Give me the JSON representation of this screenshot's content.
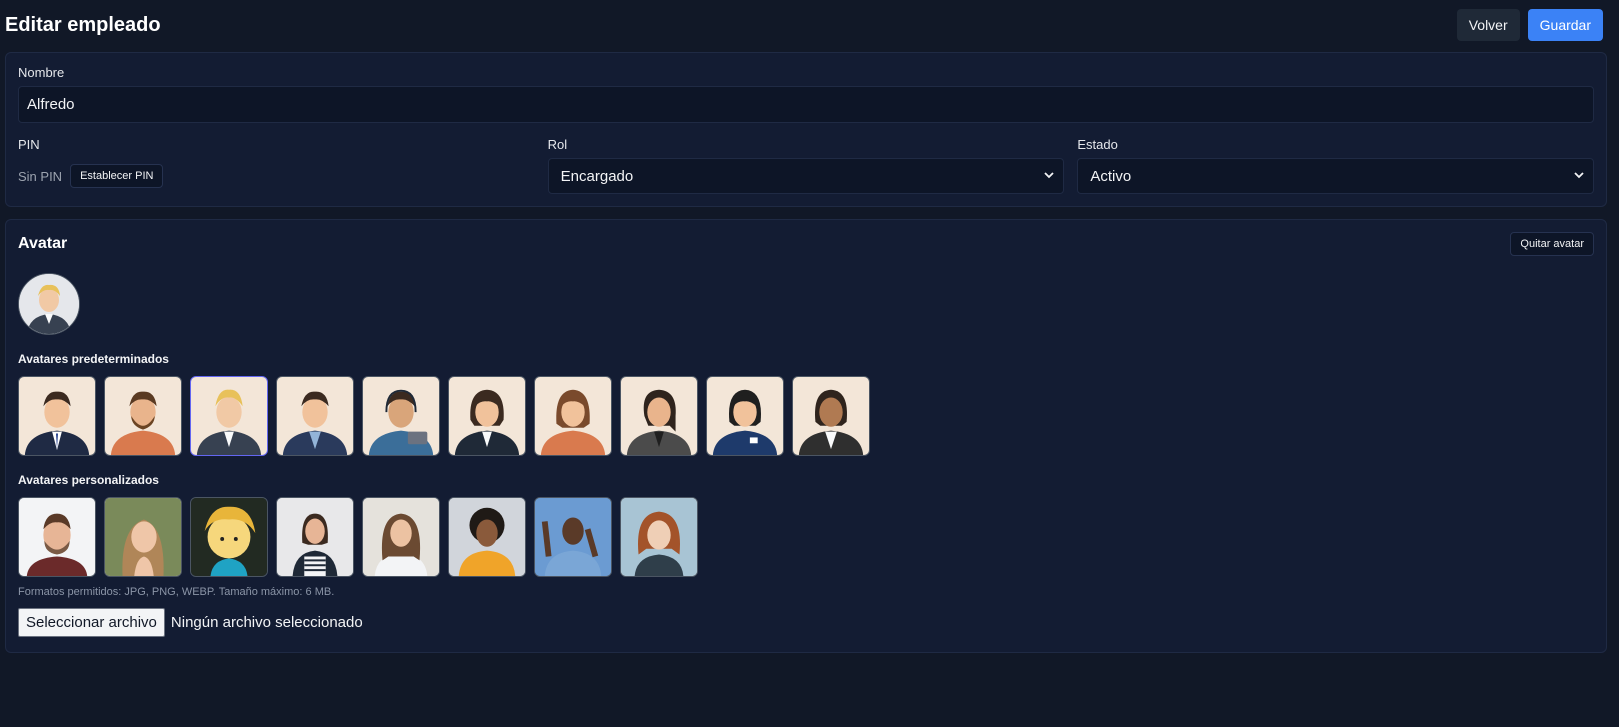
{
  "header": {
    "title": "Editar empleado",
    "back_label": "Volver",
    "save_label": "Guardar"
  },
  "form": {
    "name_label": "Nombre",
    "name_value": "Alfredo",
    "pin_label": "PIN",
    "pin_status": "Sin PIN",
    "set_pin_label": "Establecer PIN",
    "role_label": "Rol",
    "role_value": "Encargado",
    "status_label": "Estado",
    "status_value": "Activo"
  },
  "avatar": {
    "title": "Avatar",
    "remove_label": "Quitar avatar",
    "default_title": "Avatares predeterminados",
    "custom_title": "Avatares personalizados",
    "hint": "Formatos permitidos: JPG, PNG, WEBP. Tamaño máximo: 6 MB.",
    "file_button": "Seleccionar archivo",
    "file_status": "Ningún archivo seleccionado"
  },
  "colors": {
    "background": "#111827",
    "card": "#131c33",
    "accent": "#3b82f6",
    "selected_border": "#6366f1"
  }
}
